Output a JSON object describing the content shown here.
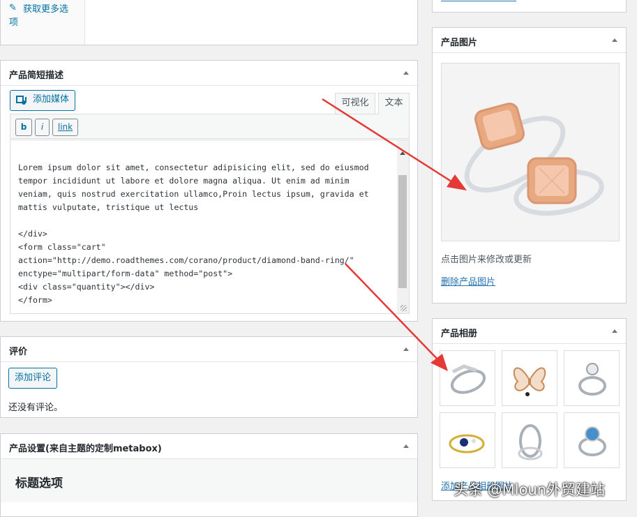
{
  "left_top_box": {
    "more_options": "获取更多选\n项"
  },
  "short_description": {
    "title": "产品简短描述",
    "add_media": "添加媒体",
    "tab_visual": "可视化",
    "tab_text": "文本",
    "quicktags": [
      "b",
      "i",
      "link"
    ],
    "content": "Lorem ipsum dolor sit amet, consectetur adipisicing elit, sed do eiusmod\ntempor incididunt ut labore et dolore magna aliqua. Ut enim ad minim\nveniam, quis nostrud exercitation ullamco,Proin lectus ipsum, gravida et\nmattis vulputate, tristique ut lectus\n\n</div>\n<form class=\"cart\"\naction=\"http://demo.roadthemes.com/corano/product/diamond-band-ring/\"\nenctype=\"multipart/form-data\" method=\"post\">\n<div class=\"quantity\"></div>\n</form>"
  },
  "reviews": {
    "title": "评价",
    "add_review": "添加评论",
    "empty_text": "还没有评论。"
  },
  "product_settings": {
    "title": "产品设置(来自主题的定制metabox)",
    "section_title": "标题选项"
  },
  "product_image": {
    "title": "产品图片",
    "hint": "点击图片来修改或更新",
    "remove_link": "删除产品图片"
  },
  "product_gallery": {
    "title": "产品相册",
    "items": [
      "ring-thumbnail-1",
      "butterfly-brooch-thumbnail",
      "ring-thumbnail-3",
      "ring-thumbnail-4",
      "ring-thumbnail-5",
      "ring-thumbnail-6"
    ],
    "add_link": "添加产品相册图片"
  },
  "watermark": "头条 @Mloun外贸建站",
  "colors": {
    "accent": "#0071a1",
    "link": "#2271b1",
    "annotation_arrow": "#e53935"
  }
}
